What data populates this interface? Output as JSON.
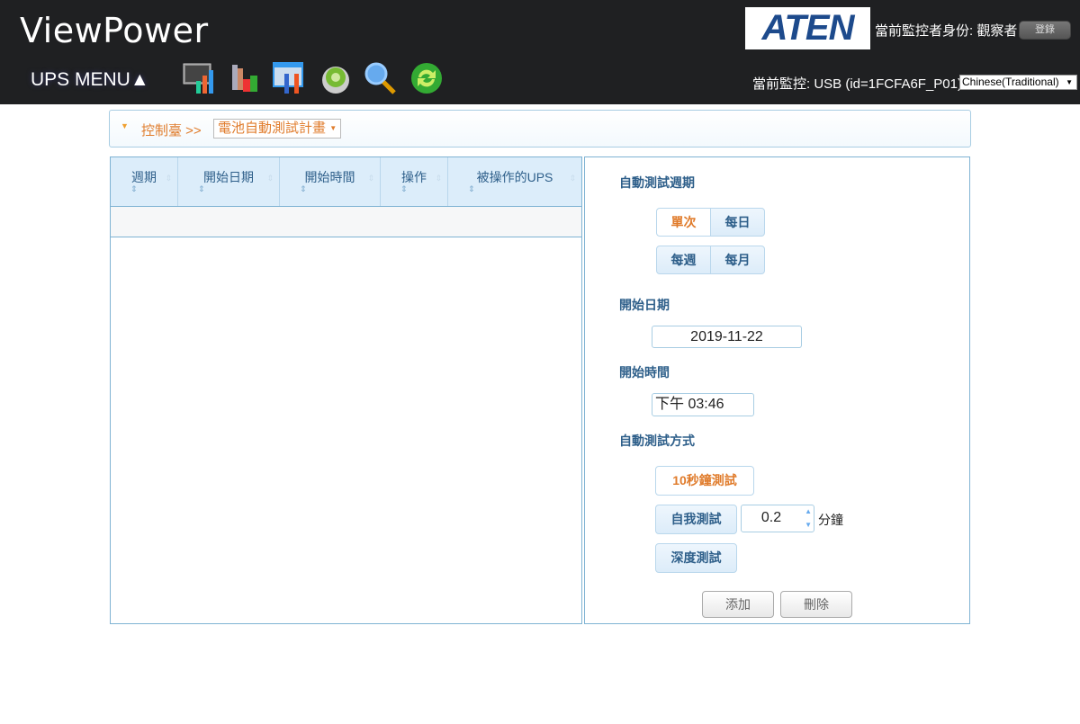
{
  "header": {
    "title": "ViewPower",
    "ups_menu": "UPS MENU▲",
    "logo": "ATEN",
    "user_label": "當前監控者身份: 觀察者",
    "login": "登錄",
    "monitor": "當前監控: USB (id=1FCFA6F_P01)",
    "language": "Chinese(Traditional)",
    "toolbar_icons": [
      "monitor-chart-icon",
      "data-log-icon",
      "configuration-icon",
      "settings-gear-icon",
      "search-icon",
      "refresh-icon"
    ]
  },
  "breadcrumb": {
    "home": "控制臺 >>",
    "page": "電池自動測試計畫"
  },
  "table": {
    "columns": [
      "週期",
      "開始日期",
      "開始時間",
      "操作",
      "被操作的UPS"
    ],
    "rows": []
  },
  "form": {
    "period_label": "自動測試週期",
    "periods": [
      "單次",
      "每日",
      "每週",
      "每月"
    ],
    "selected_period": "單次",
    "date_label": "開始日期",
    "date": "2019-11-22",
    "time_label": "開始時間",
    "time": "下午 03:46",
    "method_label": "自動測試方式",
    "methods": [
      "10秒鐘測試",
      "自我測試",
      "深度測試"
    ],
    "selected_method": "10秒鐘測試",
    "self_test_value": "0.2",
    "self_test_unit": "分鐘",
    "add": "添加",
    "delete": "刪除"
  },
  "colors": {
    "header_bg": "#1f2022",
    "accent": "#e07c2c",
    "label": "#2e5f8a",
    "border": "#7fb3d3"
  }
}
